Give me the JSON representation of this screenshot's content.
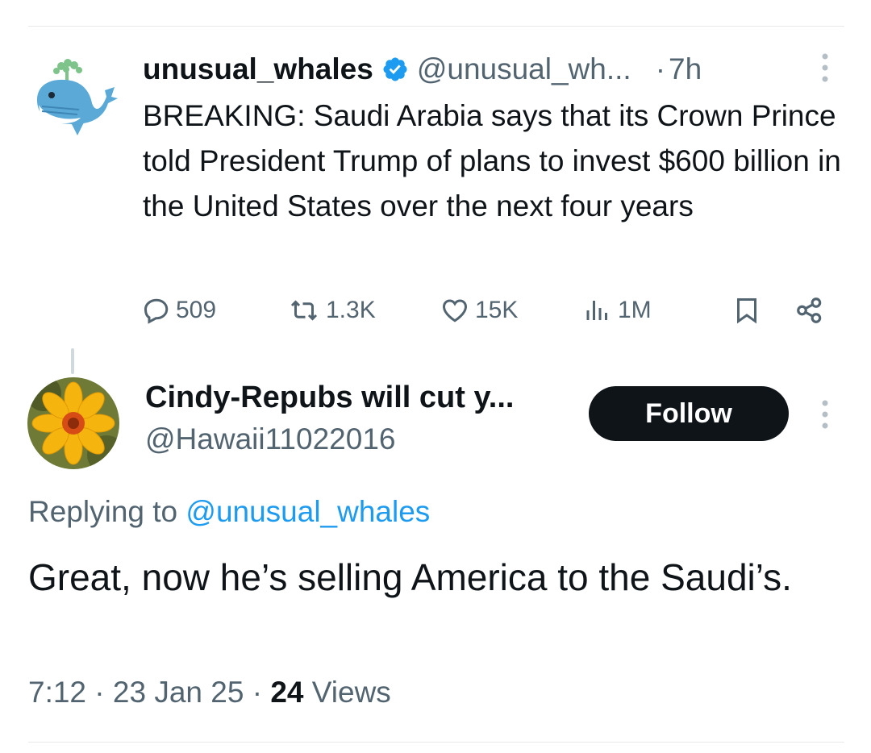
{
  "parent_tweet": {
    "display_name": "unusual_whales",
    "handle": "@unusual_wh...",
    "separator": "·",
    "time_ago": "7h",
    "avatar": "whale-avatar",
    "verified_icon": "verified-badge-icon",
    "text": "BREAKING: Saudi Arabia says that its Crown Prince told President Trump of plans to invest $600 billion in the United States over the next four years",
    "actions": {
      "replies": "509",
      "reposts": "1.3K",
      "likes": "15K",
      "views": "1M"
    }
  },
  "reply_tweet": {
    "display_name": "Cindy-Repubs will cut y...",
    "handle": "@Hawaii11022016",
    "avatar": "yellow-flower-avatar",
    "follow_label": "Follow",
    "replying_to_prefix": "Replying to",
    "replying_to_handle": "@unusual_whales",
    "text": "Great, now he’s selling America to the Saudi’s.",
    "time": "7:12",
    "date": "23 Jan 25",
    "separator": "·",
    "views_count": "24",
    "views_label": "Views"
  },
  "colors": {
    "text_primary": "#0f1419",
    "text_secondary": "#536471",
    "link": "#1d9bf0",
    "button_dark": "#0f1419",
    "divider": "#e7e9ea"
  }
}
